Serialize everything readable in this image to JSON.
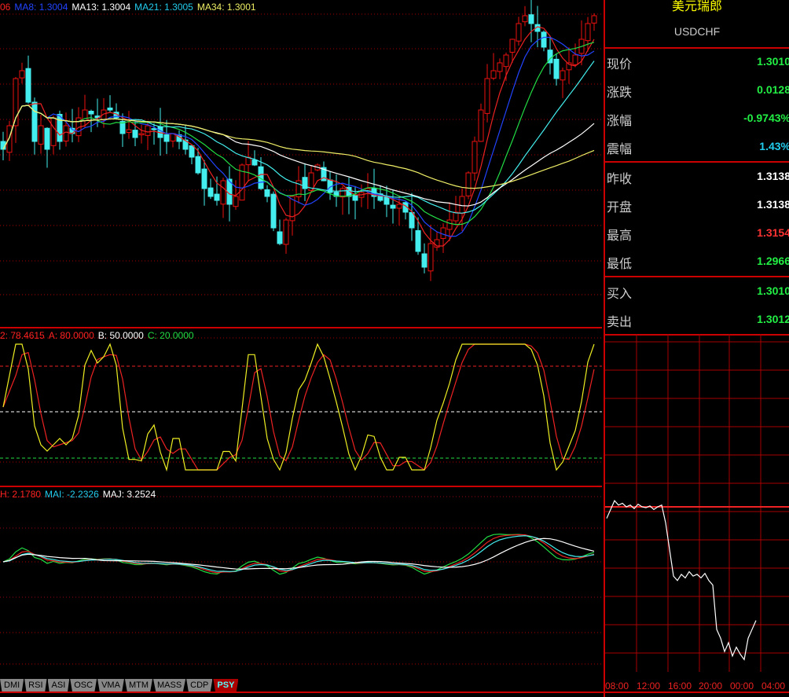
{
  "main_legend": {
    "prefix": "06",
    "ma8": "MA8: 1.3004",
    "ma13": "MA13: 1.3004",
    "ma21": "MA21: 1.3005",
    "ma34": "MA34: 1.3001"
  },
  "kd_legend": {
    "d": "2: 78.4615",
    "a": "A: 80.0000",
    "b": "B: 50.0000",
    "c": "C: 20.0000"
  },
  "macd_legend": {
    "h": "H: 2.1780",
    "mai": "MAI: -2.2326",
    "maj": "MAJ: 3.2524"
  },
  "tabs": [
    "DMI",
    "RSI",
    "ASI",
    "OSC",
    "VMA",
    "MTM",
    "MASS",
    "CDP",
    "PSY"
  ],
  "active_tab": "PSY",
  "quote": {
    "title": "美元瑞郎",
    "symbol": "USDCHF",
    "rows": [
      {
        "label": "现价",
        "value": "1.3010",
        "color": "#22ee44"
      },
      {
        "label": "涨跌",
        "value": "0.0128",
        "color": "#22ee44"
      },
      {
        "label": "涨幅",
        "value": "-0.9743%",
        "color": "#22ee44"
      },
      {
        "label": "震幅",
        "value": "1.43%",
        "color": "#22ccee"
      },
      {
        "label": "昨收",
        "value": "1.3138",
        "color": "#ffffff"
      },
      {
        "label": "开盘",
        "value": "1.3138",
        "color": "#ffffff"
      },
      {
        "label": "最高",
        "value": "1.3154",
        "color": "#ff3333"
      },
      {
        "label": "最低",
        "value": "1.2966",
        "color": "#22ee44"
      },
      {
        "label": "买入",
        "value": "1.3010",
        "color": "#22ee44"
      },
      {
        "label": "卖出",
        "value": "1.3012",
        "color": "#22ee44"
      }
    ]
  },
  "intraday": {
    "times": [
      "08:00",
      "12:00",
      "16:00",
      "20:00",
      "00:00",
      "04:00"
    ],
    "prev_close": 1.3138,
    "prices": [
      1.3125,
      1.3135,
      1.3145,
      1.314,
      1.3142,
      1.3138,
      1.314,
      1.3136,
      1.3141,
      1.3138,
      1.3137,
      1.3139,
      1.3135,
      1.3138,
      1.314,
      1.312,
      1.309,
      1.306,
      1.3055,
      1.3062,
      1.3058,
      1.3065,
      1.306,
      1.3062,
      1.3058,
      1.3063,
      1.3055,
      1.305,
      1.3,
      1.299,
      1.2975,
      1.2985,
      1.297,
      1.298,
      1.2972,
      1.2966,
      1.299,
      1.3,
      1.301
    ]
  },
  "chart_data": {
    "type": "candlestick",
    "ylim": [
      1.28,
      1.32
    ],
    "closes": [
      1.3,
      1.303,
      1.309,
      1.31,
      1.306,
      1.301,
      1.303,
      1.3,
      1.304,
      1.301,
      1.303,
      1.302,
      1.304,
      1.305,
      1.3045,
      1.304,
      1.305,
      1.305,
      1.304,
      1.302,
      1.3025,
      1.3015,
      1.302,
      1.303,
      1.3025,
      1.3015,
      1.301,
      1.302,
      1.301,
      1.3,
      1.299,
      1.297,
      1.295,
      1.294,
      1.2935,
      1.296,
      1.293,
      1.294,
      1.298,
      1.299,
      1.298,
      1.295,
      1.294,
      1.29,
      1.288,
      1.291,
      1.294,
      1.296,
      1.295,
      1.297,
      1.298,
      1.296,
      1.2945,
      1.294,
      1.295,
      1.294,
      1.2935,
      1.2945,
      1.295,
      1.294,
      1.2935,
      1.293,
      1.2925,
      1.293,
      1.292,
      1.29,
      1.287,
      1.285,
      1.288,
      1.2885,
      1.29,
      1.291,
      1.292,
      1.294,
      1.297,
      1.301,
      1.305,
      1.309,
      1.31,
      1.311,
      1.312,
      1.314,
      1.316,
      1.317,
      1.316,
      1.315,
      1.313,
      1.311,
      1.309,
      1.31,
      1.311,
      1.312,
      1.314,
      1.316,
      1.317
    ]
  }
}
